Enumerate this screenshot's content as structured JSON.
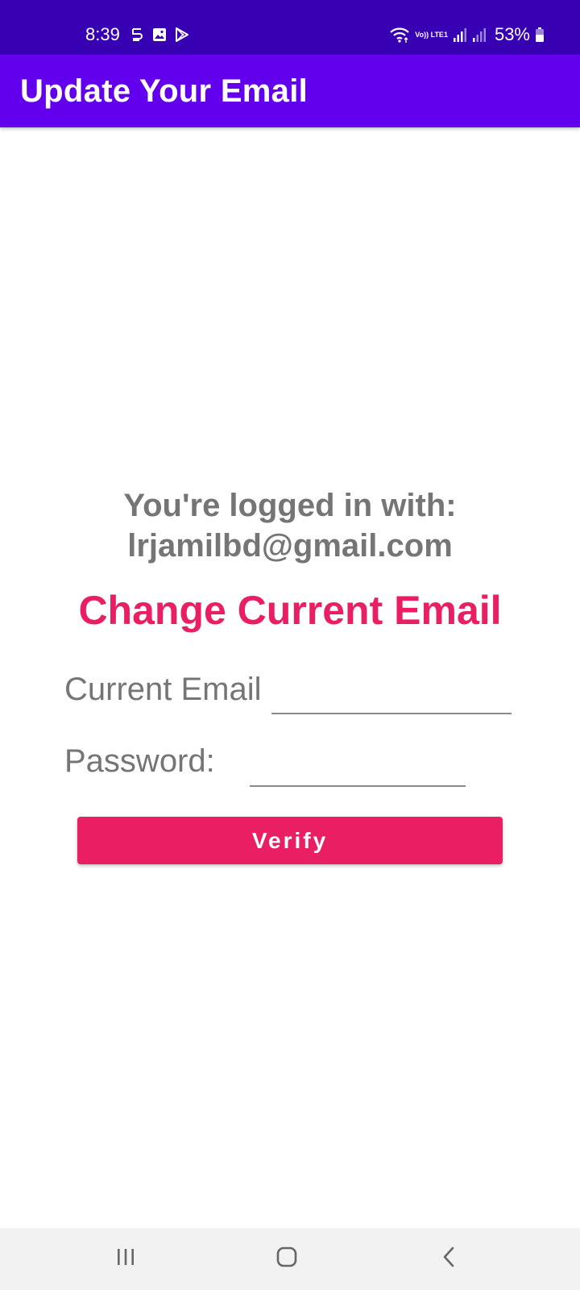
{
  "status_bar": {
    "time": "8:39",
    "left_icons": [
      "s-app-icon",
      "gallery-icon",
      "play-store-icon"
    ],
    "right_icons": [
      "wifi-icon",
      "volte-icon",
      "signal-icon",
      "signal-icon-2",
      "battery-icon"
    ],
    "volte_text": "Vo)) LTE1",
    "battery": "53%"
  },
  "app_bar": {
    "title": "Update Your Email",
    "color": "#6200EE",
    "status_color": "#3700B3"
  },
  "account": {
    "logged_label": "You're logged in with:",
    "email": "lrjamilbd@gmail.com"
  },
  "form": {
    "heading": "Change Current Email",
    "current_email_label": "Current Email",
    "current_email_value": "",
    "password_label": "Password:",
    "password_value": "",
    "verify_label": "Verify",
    "accent_color": "#E91E63"
  },
  "nav_bar": {
    "buttons": [
      "recents-icon",
      "home-icon",
      "back-icon"
    ]
  }
}
